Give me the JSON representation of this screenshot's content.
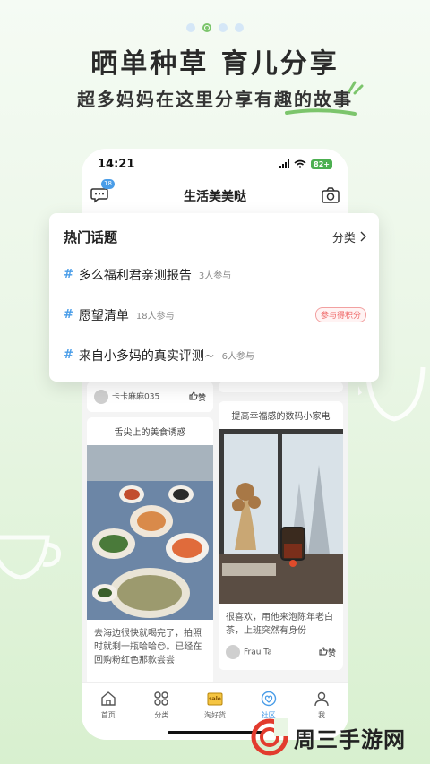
{
  "banner": {
    "headline": "晒单种草 育儿分享",
    "subline": "超多妈妈在这里分享有趣的故事",
    "page_dots": 4,
    "active_dot": 1
  },
  "status_bar": {
    "time": "14:21",
    "battery": "82+"
  },
  "header": {
    "title": "生活美美哒",
    "message_badge": "18"
  },
  "topics_panel": {
    "title": "热门话题",
    "more_label": "分类",
    "items": [
      {
        "hash": "#",
        "name": "多么福利君亲测报告",
        "count": "3人参与",
        "tag": ""
      },
      {
        "hash": "#",
        "name": "愿望清单",
        "count": "18人参与",
        "tag": "参与得积分"
      },
      {
        "hash": "#",
        "name": "来自小多妈的真实评测~",
        "count": "6人参与",
        "tag": ""
      }
    ]
  },
  "feed": {
    "top_left_user": "卡卡麻麻035",
    "top_left_like": "赞",
    "left_card": {
      "title": "舌尖上的美食诱惑",
      "text": "去海边很快就喝完了，拍照时就剩一瓶哈哈😊。已经在回购粉红色那款尝尝"
    },
    "right_card": {
      "title": "提高幸福感的数码小家电",
      "text": "很喜欢，用他来泡陈年老白茶，上班突然有身份",
      "user": "Frau Ta",
      "like": "赞"
    }
  },
  "tabbar": {
    "items": [
      {
        "label": "首页",
        "icon": "home-icon"
      },
      {
        "label": "分类",
        "icon": "grid-icon"
      },
      {
        "label": "淘好货",
        "icon": "sale-icon"
      },
      {
        "label": "社区",
        "icon": "community-icon"
      },
      {
        "label": "我",
        "icon": "profile-icon"
      }
    ],
    "active_index": 3,
    "sale_text": "sale"
  },
  "watermark": {
    "text": "周三手游网"
  },
  "colors": {
    "accent": "#4a9de8",
    "green": "#7cc56c",
    "tag_red": "#ef6a6a"
  }
}
